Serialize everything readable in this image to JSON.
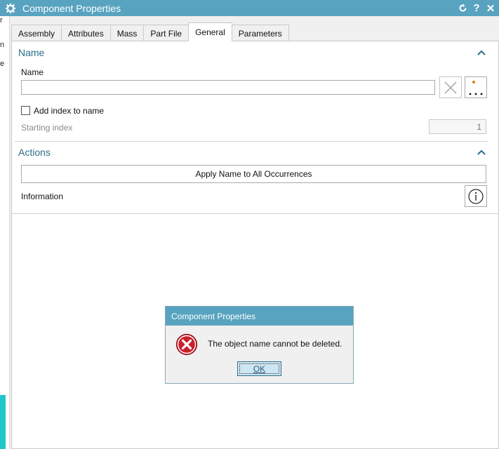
{
  "window": {
    "title": "Component Properties",
    "icons": {
      "settings": "gear-icon",
      "reset": "reset-icon",
      "help": "help-icon",
      "close": "close-icon"
    },
    "help_glyph": "?",
    "close_glyph": "✕"
  },
  "background_app": {
    "chars": [
      "r",
      "n",
      "e"
    ]
  },
  "tabs": [
    {
      "label": "Assembly",
      "active": false
    },
    {
      "label": "Attributes",
      "active": false
    },
    {
      "label": "Mass",
      "active": false
    },
    {
      "label": "Part File",
      "active": false
    },
    {
      "label": "General",
      "active": true
    },
    {
      "label": "Parameters",
      "active": false
    }
  ],
  "name_section": {
    "title": "Name",
    "name_label": "Name",
    "name_value": "",
    "add_index_label": "Add index to name",
    "add_index_checked": false,
    "starting_index_label": "Starting index",
    "starting_index_value": "1"
  },
  "actions_section": {
    "title": "Actions",
    "apply_label": "Apply Name to All Occurrences",
    "information_label": "Information"
  },
  "modal": {
    "title": "Component Properties",
    "message": "The object name cannot be deleted.",
    "ok_label": "OK"
  },
  "colors": {
    "titlebar": "#58a3c0",
    "section_title": "#2b6e8a",
    "error_red": "#c8202c",
    "accent_orange": "#e07a1a"
  }
}
